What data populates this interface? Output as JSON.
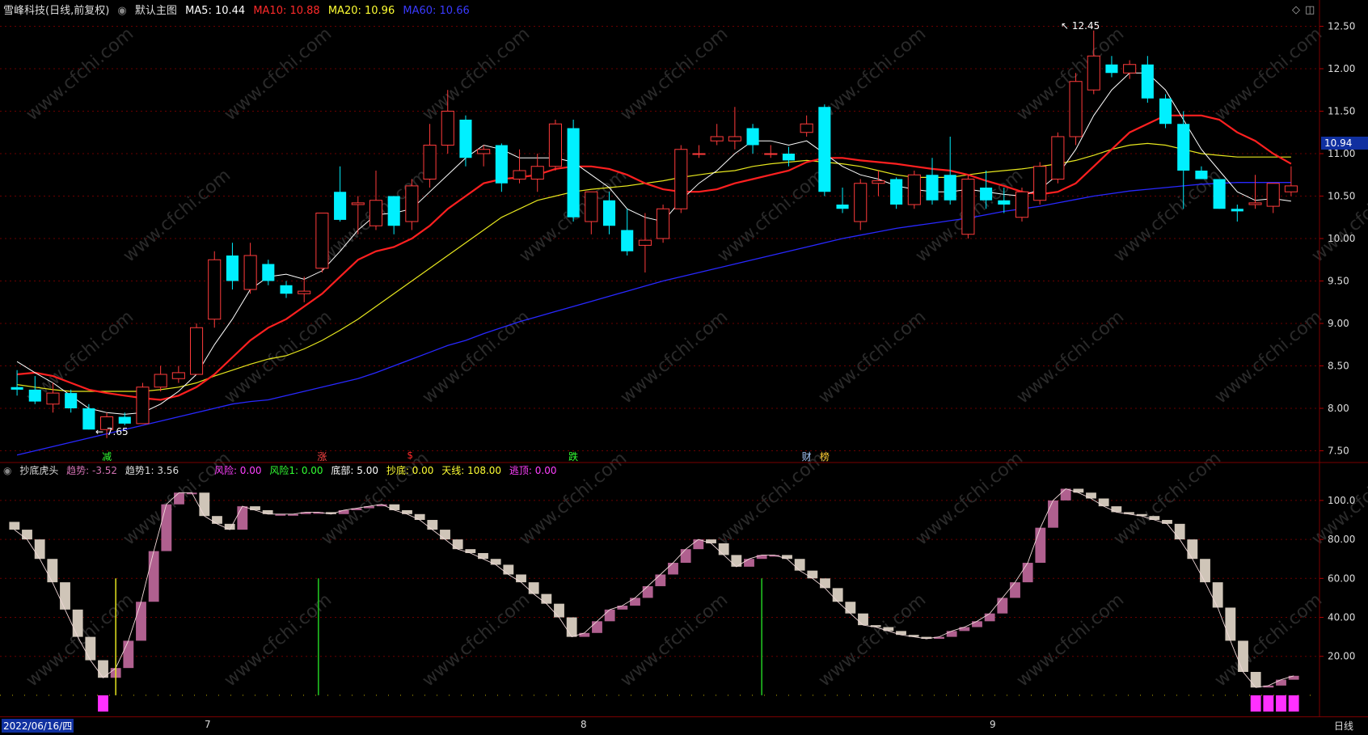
{
  "main_header": {
    "title": "雪峰科技(日线,前复权)",
    "template": "默认主图",
    "ma": [
      {
        "label": "MA5: 10.44",
        "color": "#ffffff"
      },
      {
        "label": "MA10: 10.88",
        "color": "#ff2a2a"
      },
      {
        "label": "MA20: 10.96",
        "color": "#ffff33"
      },
      {
        "label": "MA60: 10.66",
        "color": "#3a3aff"
      }
    ]
  },
  "sub_header": {
    "title": "抄底虎头",
    "items": [
      {
        "label": "趋势: -3.52",
        "color": "#d070b0"
      },
      {
        "label": "趋势1: 3.56",
        "color": "#dddddd"
      },
      {
        "label": "风险: 0.00",
        "color": "#ff40ff"
      },
      {
        "label": "风险1: 0.00",
        "color": "#33ff33"
      },
      {
        "label": "底部: 5.00",
        "color": "#ffffff"
      },
      {
        "label": "抄底: 0.00",
        "color": "#ffff33"
      },
      {
        "label": "天线: 108.00",
        "color": "#ffff33"
      },
      {
        "label": "逃顶: 0.00",
        "color": "#ff40ff"
      }
    ]
  },
  "price_axis": [
    "12.50",
    "12.00",
    "11.50",
    "11.00",
    "10.50",
    "10.00",
    "9.50",
    "9.00",
    "8.50",
    "8.00",
    "7.50"
  ],
  "sub_axis": [
    "100.0",
    "80.00",
    "60.00",
    "40.00",
    "20.00"
  ],
  "current_price": "10.94",
  "high_label": "12.45",
  "low_label": "7.65",
  "events": [
    {
      "label": "减",
      "color": "#33ff33",
      "bar": 5
    },
    {
      "label": "涨",
      "color": "#ff4444",
      "bar": 17
    },
    {
      "label": "$",
      "color": "#ff2a2a",
      "bar": 22
    },
    {
      "label": "跌",
      "color": "#33ff33",
      "bar": 31
    },
    {
      "label": "财",
      "color": "#aaccff",
      "bar": 44
    },
    {
      "label": "榜",
      "color": "#ffcc33",
      "bar": 45
    }
  ],
  "date_axis": {
    "start": "2022/06/16/四",
    "months": [
      "7",
      "8",
      "9"
    ],
    "period": "日线"
  },
  "colors": {
    "up": "#ff3b3b",
    "down": "#00f0ff",
    "ma5": "#ffffff",
    "ma10": "#ff2020",
    "ma20": "#e6e61e",
    "ma60": "#2828ff",
    "trend_up": "#b0608f",
    "trend_down": "#cfc5b8",
    "risk": "#ff30ff",
    "grid": "#6a0000"
  },
  "watermark": "www.cfchi.com",
  "chart_data": [
    {
      "type": "candlestick",
      "title": "雪峰科技(日线,前复权)",
      "ylim": [
        7.4,
        12.6
      ],
      "ohlc": [
        [
          8.25,
          8.45,
          8.15,
          8.22
        ],
        [
          8.22,
          8.38,
          8.05,
          8.08
        ],
        [
          8.05,
          8.3,
          7.95,
          8.18
        ],
        [
          8.18,
          8.22,
          7.95,
          8.0
        ],
        [
          8.0,
          8.05,
          7.75,
          7.75
        ],
        [
          7.75,
          7.95,
          7.65,
          7.9
        ],
        [
          7.9,
          7.95,
          7.8,
          7.82
        ],
        [
          7.82,
          8.3,
          7.82,
          8.25
        ],
        [
          8.25,
          8.5,
          8.2,
          8.4
        ],
        [
          8.35,
          8.5,
          8.3,
          8.42
        ],
        [
          8.4,
          9.0,
          8.4,
          8.95
        ],
        [
          9.05,
          9.85,
          8.95,
          9.75
        ],
        [
          9.8,
          9.95,
          9.4,
          9.5
        ],
        [
          9.4,
          9.95,
          9.35,
          9.8
        ],
        [
          9.7,
          9.75,
          9.45,
          9.5
        ],
        [
          9.45,
          9.5,
          9.3,
          9.35
        ],
        [
          9.35,
          9.55,
          9.25,
          9.38
        ],
        [
          9.65,
          10.3,
          9.6,
          10.3
        ],
        [
          10.55,
          10.85,
          10.2,
          10.22
        ],
        [
          10.4,
          10.5,
          10.05,
          10.42
        ],
        [
          10.15,
          10.8,
          10.1,
          10.45
        ],
        [
          10.5,
          10.5,
          10.05,
          10.15
        ],
        [
          10.2,
          10.7,
          10.1,
          10.62
        ],
        [
          10.7,
          11.35,
          10.6,
          11.1
        ],
        [
          11.1,
          11.75,
          11.0,
          11.5
        ],
        [
          11.4,
          11.45,
          10.85,
          10.95
        ],
        [
          11.0,
          11.1,
          10.85,
          11.05
        ],
        [
          11.1,
          11.12,
          10.55,
          10.65
        ],
        [
          10.7,
          11.05,
          10.65,
          10.8
        ],
        [
          10.7,
          11.0,
          10.55,
          10.85
        ],
        [
          10.85,
          11.4,
          10.8,
          11.35
        ],
        [
          11.3,
          11.4,
          10.2,
          10.25
        ],
        [
          10.2,
          10.55,
          10.05,
          10.55
        ],
        [
          10.45,
          10.55,
          10.05,
          10.15
        ],
        [
          10.1,
          10.35,
          9.8,
          9.85
        ],
        [
          9.92,
          10.3,
          9.6,
          9.98
        ],
        [
          10.0,
          10.4,
          9.95,
          10.35
        ],
        [
          10.35,
          11.1,
          10.3,
          11.05
        ],
        [
          11.0,
          11.1,
          10.95,
          11.0
        ],
        [
          11.15,
          11.35,
          11.1,
          11.2
        ],
        [
          11.15,
          11.55,
          11.05,
          11.2
        ],
        [
          11.3,
          11.35,
          11.0,
          11.1
        ],
        [
          11.0,
          11.1,
          10.95,
          11.0
        ],
        [
          11.0,
          11.08,
          10.85,
          10.92
        ],
        [
          11.25,
          11.45,
          11.2,
          11.35
        ],
        [
          11.55,
          11.58,
          10.5,
          10.55
        ],
        [
          10.4,
          10.6,
          10.3,
          10.35
        ],
        [
          10.2,
          10.7,
          10.1,
          10.65
        ],
        [
          10.65,
          10.8,
          10.5,
          10.68
        ],
        [
          10.7,
          10.72,
          10.35,
          10.4
        ],
        [
          10.4,
          10.8,
          10.35,
          10.75
        ],
        [
          10.75,
          10.95,
          10.4,
          10.45
        ],
        [
          10.75,
          11.2,
          10.4,
          10.45
        ],
        [
          10.05,
          10.75,
          10.0,
          10.7
        ],
        [
          10.6,
          10.8,
          10.35,
          10.45
        ],
        [
          10.45,
          10.6,
          10.3,
          10.4
        ],
        [
          10.25,
          10.6,
          10.2,
          10.55
        ],
        [
          10.45,
          10.9,
          10.4,
          10.85
        ],
        [
          10.7,
          11.25,
          10.65,
          11.2
        ],
        [
          11.2,
          11.95,
          11.1,
          11.85
        ],
        [
          11.75,
          12.45,
          11.7,
          12.15
        ],
        [
          12.05,
          12.15,
          11.9,
          11.95
        ],
        [
          11.95,
          12.1,
          11.88,
          12.05
        ],
        [
          12.05,
          12.15,
          11.6,
          11.65
        ],
        [
          11.65,
          11.7,
          11.3,
          11.35
        ],
        [
          11.35,
          11.5,
          10.35,
          10.8
        ],
        [
          10.8,
          10.85,
          10.7,
          10.7
        ],
        [
          10.7,
          10.7,
          10.35,
          10.35
        ],
        [
          10.35,
          10.4,
          10.2,
          10.32
        ],
        [
          10.4,
          10.75,
          10.35,
          10.42
        ],
        [
          10.38,
          10.65,
          10.3,
          10.65
        ],
        [
          10.55,
          10.85,
          10.5,
          10.62
        ]
      ],
      "ma5": [
        8.55,
        8.42,
        8.3,
        8.15,
        8.0,
        7.95,
        7.93,
        7.95,
        8.05,
        8.2,
        8.4,
        8.75,
        9.05,
        9.4,
        9.55,
        9.58,
        9.52,
        9.62,
        9.85,
        10.1,
        10.28,
        10.3,
        10.35,
        10.55,
        10.75,
        10.95,
        11.1,
        11.05,
        10.95,
        10.95,
        10.95,
        10.9,
        10.75,
        10.6,
        10.35,
        10.25,
        10.2,
        10.45,
        10.65,
        10.8,
        11.0,
        11.15,
        11.15,
        11.1,
        11.15,
        11.0,
        10.85,
        10.75,
        10.7,
        10.62,
        10.58,
        10.55,
        10.55,
        10.58,
        10.55,
        10.52,
        10.5,
        10.58,
        10.75,
        11.05,
        11.45,
        11.75,
        11.95,
        11.95,
        11.75,
        11.4,
        11.05,
        10.8,
        10.55,
        10.45,
        10.47,
        10.44
      ],
      "ma10": [
        8.4,
        8.42,
        8.38,
        8.3,
        8.22,
        8.18,
        8.15,
        8.12,
        8.1,
        8.15,
        8.25,
        8.4,
        8.6,
        8.8,
        8.95,
        9.05,
        9.2,
        9.35,
        9.55,
        9.75,
        9.85,
        9.9,
        10.0,
        10.15,
        10.35,
        10.5,
        10.65,
        10.7,
        10.72,
        10.75,
        10.82,
        10.85,
        10.85,
        10.82,
        10.75,
        10.65,
        10.58,
        10.55,
        10.55,
        10.58,
        10.65,
        10.7,
        10.75,
        10.8,
        10.9,
        10.95,
        10.95,
        10.92,
        10.9,
        10.88,
        10.85,
        10.82,
        10.8,
        10.75,
        10.68,
        10.62,
        10.55,
        10.52,
        10.55,
        10.65,
        10.85,
        11.05,
        11.25,
        11.35,
        11.45,
        11.45,
        11.45,
        11.4,
        11.25,
        11.15,
        11.0,
        10.88
      ],
      "ma20": [
        8.28,
        8.25,
        8.22,
        8.2,
        8.2,
        8.2,
        8.2,
        8.2,
        8.22,
        8.25,
        8.3,
        8.38,
        8.45,
        8.52,
        8.58,
        8.62,
        8.7,
        8.8,
        8.92,
        9.05,
        9.2,
        9.35,
        9.5,
        9.65,
        9.8,
        9.95,
        10.1,
        10.25,
        10.35,
        10.45,
        10.5,
        10.55,
        10.58,
        10.6,
        10.62,
        10.65,
        10.68,
        10.72,
        10.75,
        10.78,
        10.8,
        10.85,
        10.88,
        10.9,
        10.92,
        10.9,
        10.88,
        10.85,
        10.8,
        10.75,
        10.72,
        10.72,
        10.72,
        10.75,
        10.78,
        10.8,
        10.82,
        10.85,
        10.88,
        10.92,
        10.98,
        11.05,
        11.1,
        11.12,
        11.1,
        11.05,
        11.0,
        10.98,
        10.96,
        10.96,
        10.96,
        10.96
      ],
      "ma60": [
        7.45,
        7.5,
        7.55,
        7.6,
        7.65,
        7.7,
        7.75,
        7.8,
        7.85,
        7.9,
        7.95,
        8.0,
        8.05,
        8.08,
        8.1,
        8.15,
        8.2,
        8.25,
        8.3,
        8.35,
        8.42,
        8.5,
        8.58,
        8.66,
        8.74,
        8.8,
        8.88,
        8.95,
        9.02,
        9.08,
        9.14,
        9.2,
        9.26,
        9.32,
        9.38,
        9.44,
        9.5,
        9.55,
        9.6,
        9.65,
        9.7,
        9.75,
        9.8,
        9.85,
        9.9,
        9.95,
        10.0,
        10.04,
        10.08,
        10.12,
        10.15,
        10.18,
        10.21,
        10.24,
        10.28,
        10.32,
        10.35,
        10.38,
        10.42,
        10.46,
        10.5,
        10.53,
        10.56,
        10.58,
        10.6,
        10.62,
        10.64,
        10.65,
        10.66,
        10.66,
        10.66,
        10.66
      ]
    },
    {
      "type": "bar",
      "title": "抄底虎头",
      "ylim": [
        -10,
        112
      ],
      "trend": [
        85,
        80,
        70,
        58,
        44,
        30,
        18,
        9,
        14,
        28,
        48,
        74,
        98,
        104,
        104,
        92,
        88,
        85,
        97,
        95,
        93,
        93,
        93,
        94,
        94,
        93,
        95,
        96,
        97,
        98,
        95,
        93,
        90,
        85,
        80,
        75,
        73,
        70,
        67,
        62,
        58,
        52,
        47,
        40,
        30,
        32,
        38,
        44,
        46,
        50,
        56,
        62,
        68,
        75,
        80,
        78,
        72,
        66,
        70,
        72,
        72,
        70,
        64,
        60,
        55,
        48,
        42,
        36,
        35,
        33,
        31,
        30,
        29,
        30,
        33,
        35,
        38,
        42,
        50,
        58,
        68,
        86,
        100,
        106,
        104,
        101,
        97,
        94,
        93,
        92,
        90,
        88,
        80,
        70,
        58,
        45,
        28,
        12,
        4,
        5,
        8,
        10
      ]
    }
  ]
}
